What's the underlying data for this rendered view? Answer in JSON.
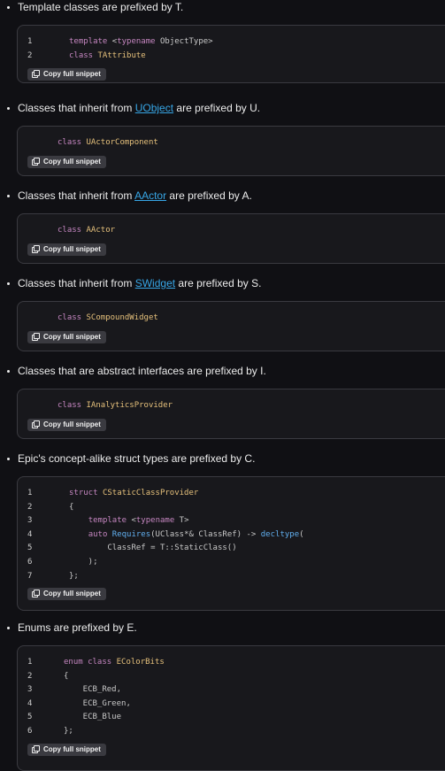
{
  "sections": [
    {
      "bullet": "Template classes are prefixed by T.",
      "lines": [
        {
          "n": "1",
          "parts": [
            {
              "t": "template ",
              "c": "kw"
            },
            {
              "t": "<",
              "c": ""
            },
            {
              "t": "typename",
              "c": "kw"
            },
            {
              "t": " ObjectType>",
              "c": ""
            }
          ]
        },
        {
          "n": "2",
          "parts": [
            {
              "t": "class ",
              "c": "kw"
            },
            {
              "t": "TAttribute",
              "c": "ty"
            }
          ]
        }
      ],
      "copy": "Copy full snippet"
    },
    {
      "bullet_pre": "Classes that inherit from ",
      "bullet_link": "UObject",
      "bullet_post": " are prefixed by U.",
      "lines": [
        {
          "n": "",
          "parts": [
            {
              "t": "class ",
              "c": "kw"
            },
            {
              "t": "UActorComponent",
              "c": "ty"
            }
          ]
        }
      ],
      "copy": "Copy full snippet"
    },
    {
      "bullet_pre": "Classes that inherit from ",
      "bullet_link": "AActor",
      "bullet_post": " are prefixed by A.",
      "lines": [
        {
          "n": "",
          "parts": [
            {
              "t": "class ",
              "c": "kw"
            },
            {
              "t": "AActor",
              "c": "ty"
            }
          ]
        }
      ],
      "copy": "Copy full snippet"
    },
    {
      "bullet_pre": "Classes that inherit from ",
      "bullet_link": "SWidget",
      "bullet_post": " are prefixed by S.",
      "lines": [
        {
          "n": "",
          "parts": [
            {
              "t": "class ",
              "c": "kw"
            },
            {
              "t": "SCompoundWidget",
              "c": "ty"
            }
          ]
        }
      ],
      "copy": "Copy full snippet"
    },
    {
      "bullet": "Classes that are abstract interfaces are prefixed by I.",
      "lines": [
        {
          "n": "",
          "parts": [
            {
              "t": "class ",
              "c": "kw"
            },
            {
              "t": "IAnalyticsProvider",
              "c": "ty"
            }
          ]
        }
      ],
      "copy": "Copy full snippet"
    },
    {
      "bullet": "Epic's concept-alike struct types are prefixed by C.",
      "lines": [
        {
          "n": "1",
          "parts": [
            {
              "t": "struct ",
              "c": "kw"
            },
            {
              "t": "CStaticClassProvider",
              "c": "ty"
            }
          ]
        },
        {
          "n": "2",
          "parts": [
            {
              "t": "{",
              "c": ""
            }
          ]
        },
        {
          "n": "3",
          "parts": [
            {
              "t": "    ",
              "c": ""
            },
            {
              "t": "template ",
              "c": "kw"
            },
            {
              "t": "<",
              "c": ""
            },
            {
              "t": "typename",
              "c": "kw"
            },
            {
              "t": " T>",
              "c": ""
            }
          ]
        },
        {
          "n": "4",
          "parts": [
            {
              "t": "    ",
              "c": ""
            },
            {
              "t": "auto ",
              "c": "kw"
            },
            {
              "t": "Requires",
              "c": "fn"
            },
            {
              "t": "(UClass*& ClassRef) -> ",
              "c": ""
            },
            {
              "t": "decltype",
              "c": "fn"
            },
            {
              "t": "(",
              "c": ""
            }
          ]
        },
        {
          "n": "5",
          "parts": [
            {
              "t": "        ClassRef = T::StaticClass()",
              "c": ""
            }
          ]
        },
        {
          "n": "6",
          "parts": [
            {
              "t": "    );",
              "c": ""
            }
          ]
        },
        {
          "n": "7",
          "parts": [
            {
              "t": "};",
              "c": ""
            }
          ]
        }
      ],
      "copy": "Copy full snippet"
    },
    {
      "bullet": "Enums are prefixed by E.",
      "lines": [
        {
          "n": "1",
          "parts": [
            {
              "t": "enum ",
              "c": "kw"
            },
            {
              "t": "class ",
              "c": "kw"
            },
            {
              "t": "EColorBits",
              "c": "ty"
            }
          ]
        },
        {
          "n": "2",
          "parts": [
            {
              "t": "{",
              "c": ""
            }
          ]
        },
        {
          "n": "3",
          "parts": [
            {
              "t": "    ECB_Red,",
              "c": ""
            }
          ]
        },
        {
          "n": "4",
          "parts": [
            {
              "t": "    ECB_Green,",
              "c": ""
            }
          ]
        },
        {
          "n": "5",
          "parts": [
            {
              "t": "    ECB_Blue",
              "c": ""
            }
          ]
        },
        {
          "n": "6",
          "parts": [
            {
              "t": "};",
              "c": ""
            }
          ]
        }
      ],
      "copy": "Copy full snippet"
    }
  ]
}
